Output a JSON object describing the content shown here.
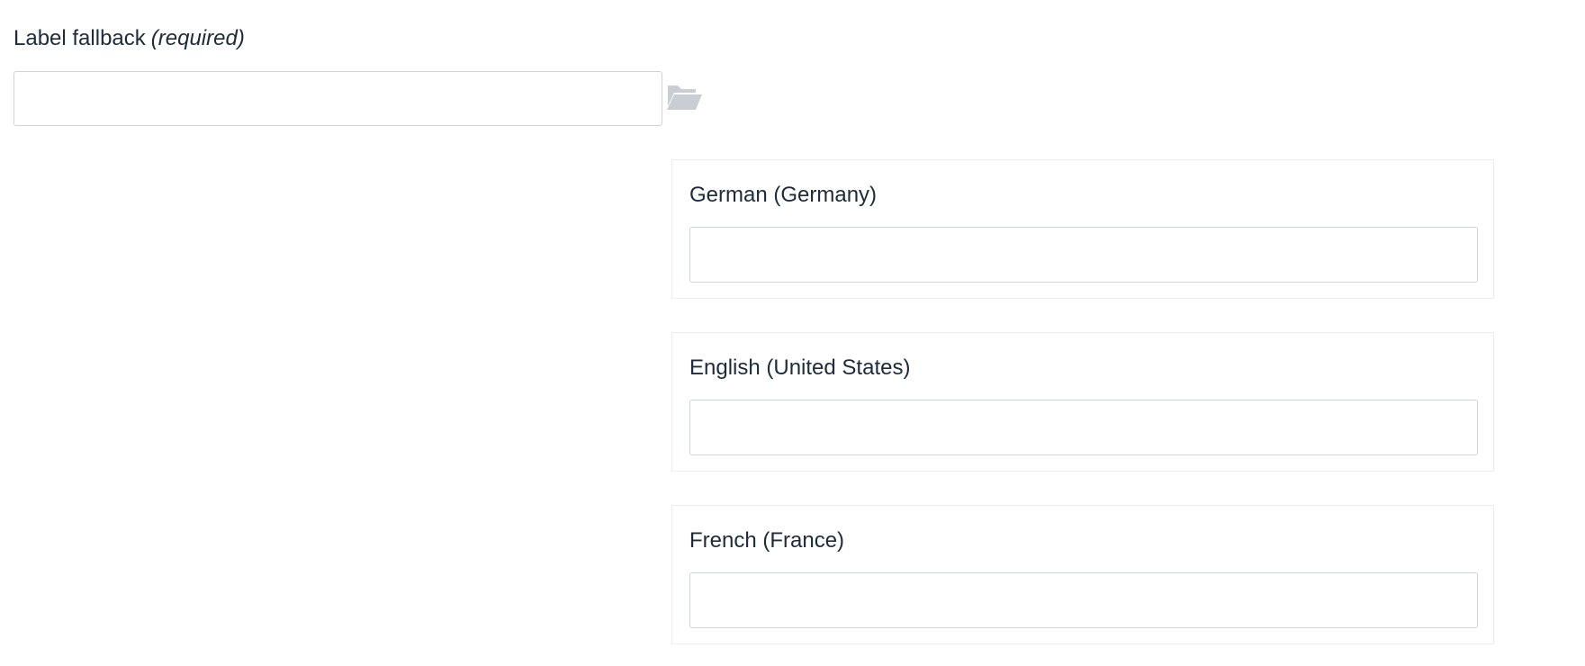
{
  "fallback": {
    "label": "Label fallback",
    "required_label": "(required)",
    "value": "",
    "placeholder": ""
  },
  "locale_icon": "folder-open-icon",
  "colors": {
    "text": "#1d2b3a",
    "input_border": "#cfd4da",
    "panel_border": "#ececec",
    "icon": "#c9ced4"
  },
  "translations": [
    {
      "label": "German (Germany)",
      "value": ""
    },
    {
      "label": "English (United States)",
      "value": ""
    },
    {
      "label": "French (France)",
      "value": ""
    }
  ]
}
